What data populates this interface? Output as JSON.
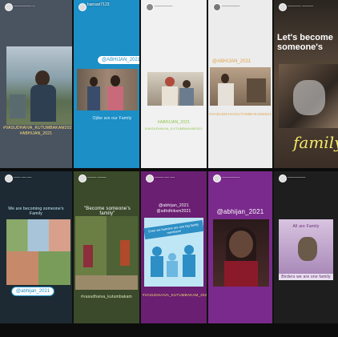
{
  "stories": [
    {
      "user": "________ _",
      "caption1": "#VASUDHAIVA_KUTUMBAKAM2021",
      "caption2": "#ABHIJAN_2021"
    },
    {
      "user": "bansari7123",
      "tag": "@ABHIJAN_2021",
      "caption": "Ojibe are our Family"
    },
    {
      "user": "________",
      "caption1": "#ABHIJAN_2021",
      "caption2": "#VASUDHAIVA_KUTUMBAKAM2021"
    },
    {
      "user": "________",
      "tag": "@ABHIJAN_2021",
      "caption": "#VASUDHAIVAKUTUMBAKAM2021"
    },
    {
      "user": "______ _____",
      "headline": "Let's become someone's",
      "script": "family"
    },
    {
      "user": "___ __ __",
      "caption": "We are becoming someone's Family",
      "tag": "@abhijan_2021"
    },
    {
      "user": "____ ____",
      "title": "\"Become someone's family\"",
      "caption": "#vasudhaiva_kutumbakam"
    },
    {
      "user": "____ __ __",
      "tag1": "@abhijan_2021",
      "tag2": "@sdhdhiksm2021",
      "banner": "Even we humans are one big family members!",
      "caption": "#VASUDHAIVA_KUTUMBAKAM_2021"
    },
    {
      "user": "________",
      "tag": "@abhijan_2021"
    },
    {
      "user": "________",
      "title": "All are Family",
      "caption": "Birders we are one family"
    }
  ]
}
